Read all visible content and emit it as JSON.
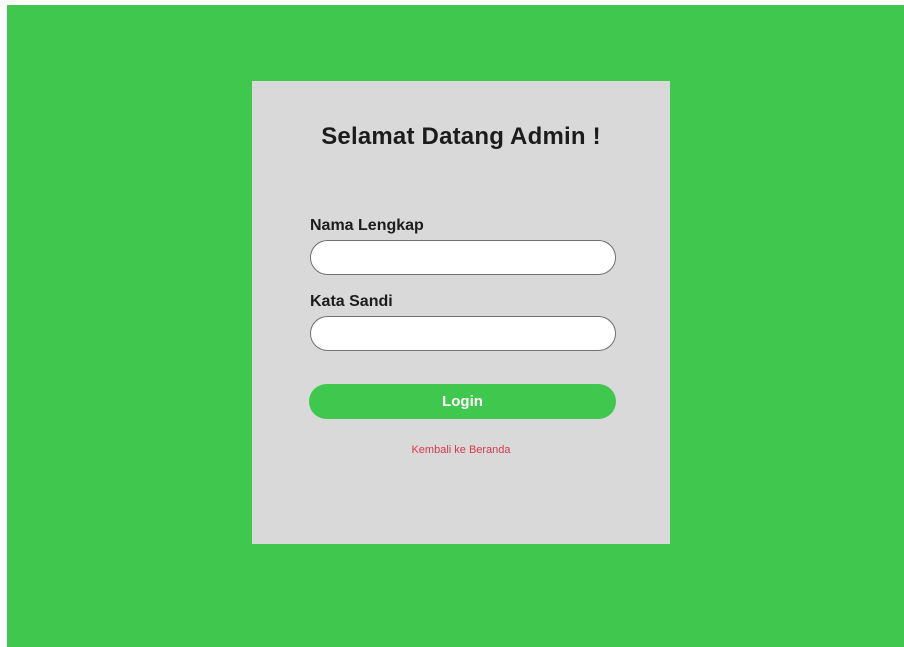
{
  "login_card": {
    "title": "Selamat Datang Admin !",
    "name_label": "Nama Lengkap",
    "name_value": "",
    "password_label": "Kata Sandi",
    "password_value": "",
    "login_label": "Login",
    "back_link": "Kembali ke Beranda"
  },
  "colors": {
    "background": "#40c74e",
    "card": "#d9d9d9",
    "button": "#40c74e",
    "link": "#d6394a"
  }
}
